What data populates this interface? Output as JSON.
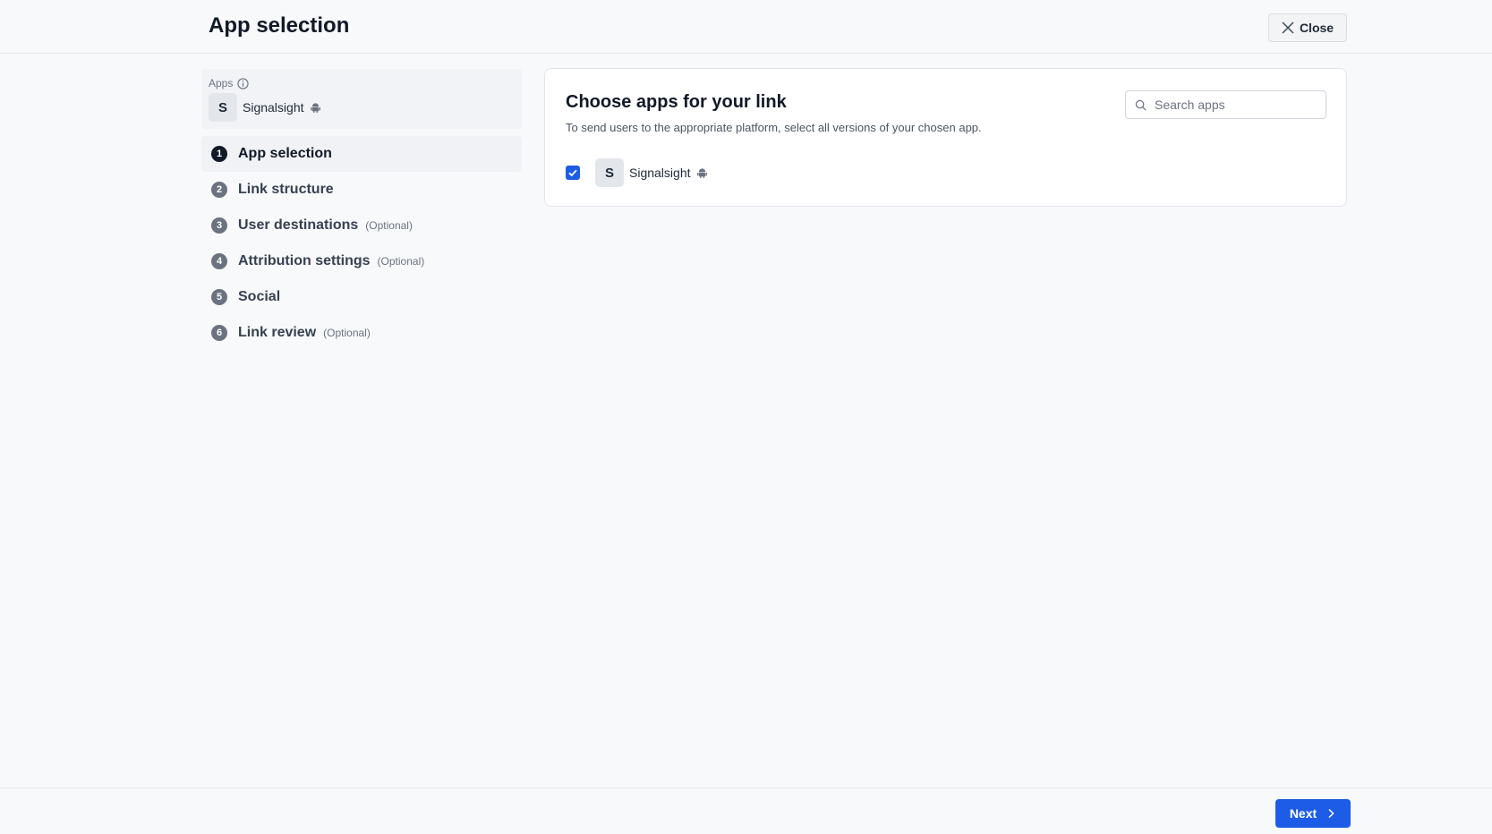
{
  "header": {
    "title": "App selection",
    "close_label": "Close"
  },
  "sidebar": {
    "apps_label": "Apps",
    "app": {
      "initial": "S",
      "name": "Signalsight",
      "platform_icon": "android-icon"
    },
    "steps": [
      {
        "num": "1",
        "label": "App selection",
        "optional": "",
        "active": true
      },
      {
        "num": "2",
        "label": "Link structure",
        "optional": ""
      },
      {
        "num": "3",
        "label": "User destinations",
        "optional": "(Optional)"
      },
      {
        "num": "4",
        "label": "Attribution settings",
        "optional": "(Optional)"
      },
      {
        "num": "5",
        "label": "Social",
        "optional": ""
      },
      {
        "num": "6",
        "label": "Link review",
        "optional": "(Optional)"
      }
    ]
  },
  "main": {
    "title": "Choose apps for your link",
    "subtitle": "To send users to the appropriate platform, select all versions of your chosen app.",
    "search": {
      "placeholder": "Search apps",
      "value": ""
    },
    "apps": [
      {
        "initial": "S",
        "name": "Signalsight",
        "checked": true,
        "platform_icon": "android-icon"
      }
    ]
  },
  "footer": {
    "next_label": "Next"
  },
  "colors": {
    "accent": "#1d5ce6",
    "active_step": "#111827",
    "inactive_step": "#6b7280"
  }
}
